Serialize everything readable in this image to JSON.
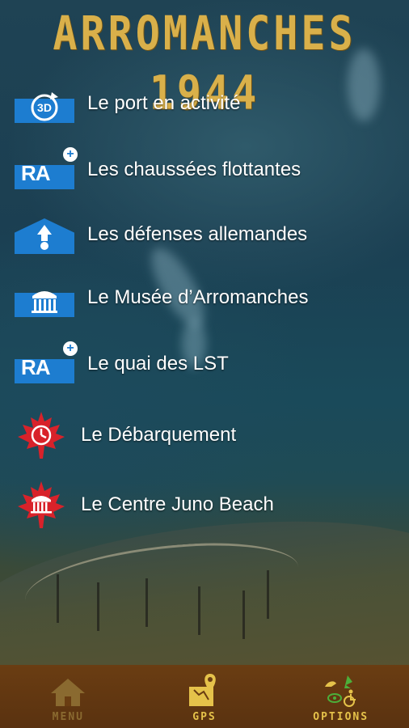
{
  "app": {
    "title": "ARROMANCHES 1944"
  },
  "menu": [
    {
      "label": "Le port en activité",
      "icon": "3d-rotate-icon"
    },
    {
      "label": "Les chaussées flottantes",
      "icon": "ra-plus-icon",
      "badge_text": "RA"
    },
    {
      "label": "Les défenses allemandes",
      "icon": "bunker-icon"
    },
    {
      "label": "Le Musée d’Arromanches",
      "icon": "museum-icon"
    },
    {
      "label": "Le quai des LST",
      "icon": "ra-plus-icon",
      "badge_text": "RA"
    },
    {
      "label": "Le Débarquement",
      "icon": "maple-leaf-clock-icon"
    },
    {
      "label": "Le Centre Juno Beach",
      "icon": "maple-leaf-museum-icon"
    }
  ],
  "badges": {
    "three_d": "3D"
  },
  "tabbar": [
    {
      "label": "MENU",
      "icon": "home-icon",
      "active": false
    },
    {
      "label": "GPS",
      "icon": "gps-map-icon",
      "active": true
    },
    {
      "label": "OPTIONS",
      "icon": "options-icon",
      "active": true
    }
  ],
  "colors": {
    "title": "#d9b04a",
    "badge_blue": "#1d7dd0",
    "leaf_red": "#d8222a",
    "tabbar": "#6a3d12",
    "tab_label": "#e5c24a"
  }
}
